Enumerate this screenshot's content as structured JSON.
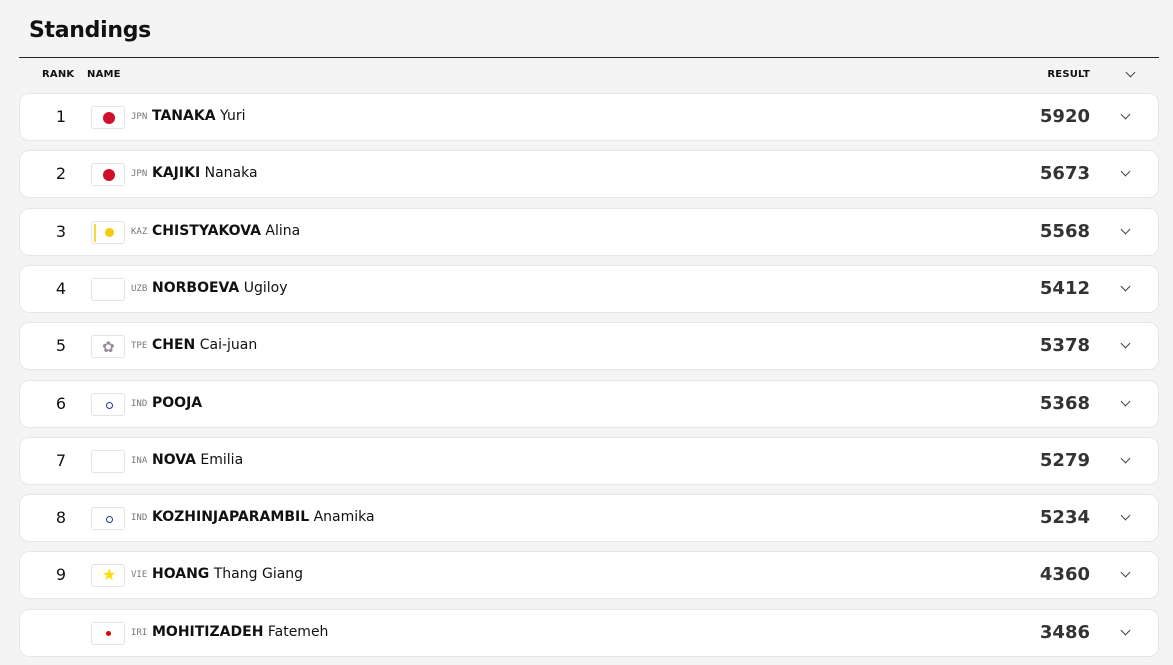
{
  "title": "Standings",
  "columns": {
    "rank": "RANK",
    "name": "NAME",
    "result": "RESULT"
  },
  "rows": [
    {
      "rank": "1",
      "noc": "JPN",
      "flag": "jpn",
      "last": "TANAKA",
      "first": "Yuri",
      "result": "5920"
    },
    {
      "rank": "2",
      "noc": "JPN",
      "flag": "jpn",
      "last": "KAJIKI",
      "first": "Nanaka",
      "result": "5673"
    },
    {
      "rank": "3",
      "noc": "KAZ",
      "flag": "kaz",
      "last": "CHISTYAKOVA",
      "first": "Alina",
      "result": "5568"
    },
    {
      "rank": "4",
      "noc": "UZB",
      "flag": "uzb",
      "last": "NORBOEVA",
      "first": "Ugiloy",
      "result": "5412"
    },
    {
      "rank": "5",
      "noc": "TPE",
      "flag": "tpe",
      "last": "CHEN",
      "first": "Cai-juan",
      "result": "5378"
    },
    {
      "rank": "6",
      "noc": "IND",
      "flag": "ind",
      "last": "POOJA",
      "first": "",
      "result": "5368"
    },
    {
      "rank": "7",
      "noc": "INA",
      "flag": "ina",
      "last": "NOVA",
      "first": "Emilia",
      "result": "5279"
    },
    {
      "rank": "8",
      "noc": "IND",
      "flag": "ind",
      "last": "KOZHINJAPARAMBIL",
      "first": "Anamika",
      "result": "5234"
    },
    {
      "rank": "9",
      "noc": "VIE",
      "flag": "vie",
      "last": "HOANG",
      "first": "Thang Giang",
      "result": "4360"
    },
    {
      "rank": "",
      "noc": "IRI",
      "flag": "iri",
      "last": "MOHITIZADEH",
      "first": "Fatemeh",
      "result": "3486"
    }
  ]
}
